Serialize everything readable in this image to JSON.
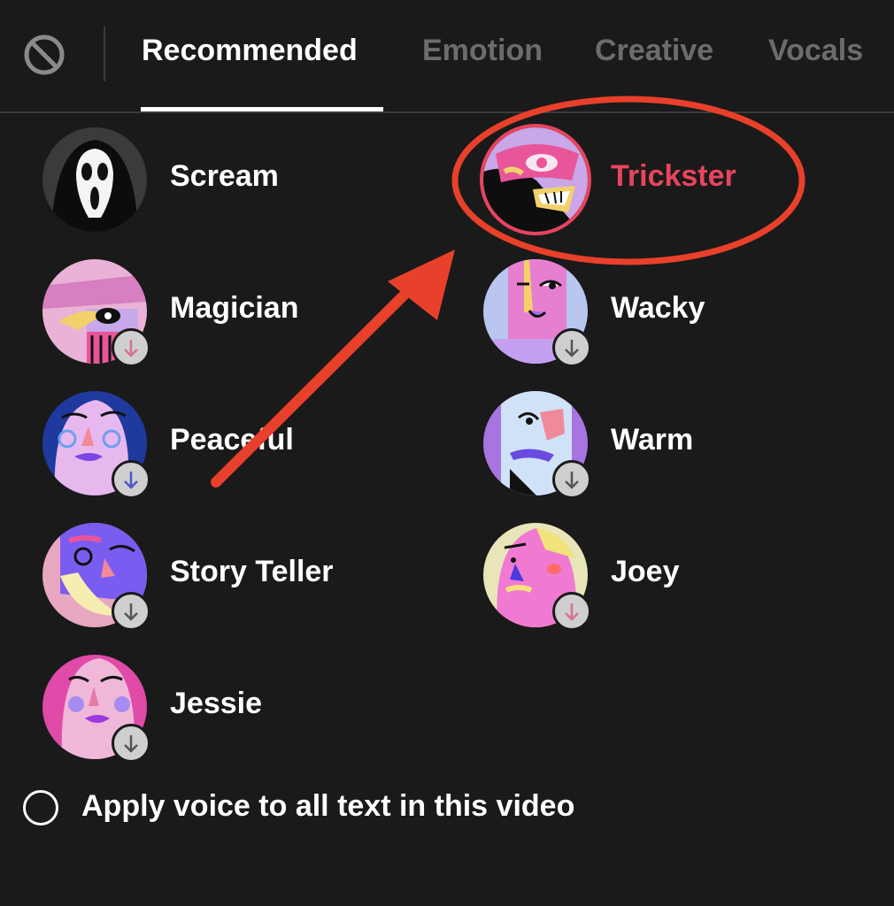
{
  "tabs": [
    {
      "label": "Recommended",
      "active": true
    },
    {
      "label": "Emotion",
      "active": false
    },
    {
      "label": "Creative",
      "active": false
    },
    {
      "label": "Vocals",
      "active": false
    }
  ],
  "voices": [
    {
      "label": "Scream",
      "selected": false,
      "downloadable": false
    },
    {
      "label": "Trickster",
      "selected": true,
      "downloadable": false
    },
    {
      "label": "Magician",
      "selected": false,
      "downloadable": true
    },
    {
      "label": "Wacky",
      "selected": false,
      "downloadable": true
    },
    {
      "label": "Peaceful",
      "selected": false,
      "downloadable": true
    },
    {
      "label": "Warm",
      "selected": false,
      "downloadable": true
    },
    {
      "label": "Story Teller",
      "selected": false,
      "downloadable": true
    },
    {
      "label": "Joey",
      "selected": false,
      "downloadable": true
    },
    {
      "label": "Jessie",
      "selected": false,
      "downloadable": true
    }
  ],
  "apply_all": {
    "label": "Apply voice to all text in this video",
    "checked": false
  },
  "colors": {
    "background": "#1a1a1a",
    "accent": "#e8445f",
    "annotation": "#e8402a",
    "inactive_tab": "#6c6c6c"
  },
  "icons": {
    "no_voice": "prohibit-icon",
    "download": "download-icon"
  }
}
